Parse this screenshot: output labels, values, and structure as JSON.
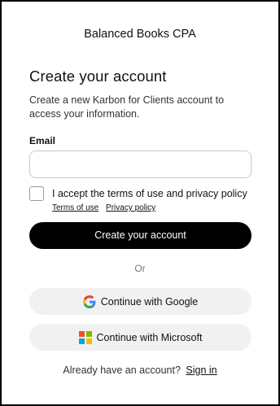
{
  "org_name": "Balanced Books CPA",
  "heading": "Create your account",
  "subtitle": "Create a new Karbon for Clients account to access your information.",
  "email": {
    "label": "Email",
    "value": "",
    "placeholder": ""
  },
  "terms": {
    "checked": false,
    "text": "I accept the terms of use and privacy policy",
    "terms_link": "Terms of use",
    "privacy_link": "Privacy policy"
  },
  "create_button": "Create your account",
  "divider": "Or",
  "google_button": {
    "label": "Continue with Google",
    "icon": "google-icon"
  },
  "microsoft_button": {
    "label": "Continue with Microsoft",
    "icon": "microsoft-icon",
    "colors": [
      "#f25022",
      "#7fba00",
      "#00a4ef",
      "#ffb900"
    ]
  },
  "signin": {
    "prompt": "Already have an account?",
    "link": "Sign in"
  }
}
